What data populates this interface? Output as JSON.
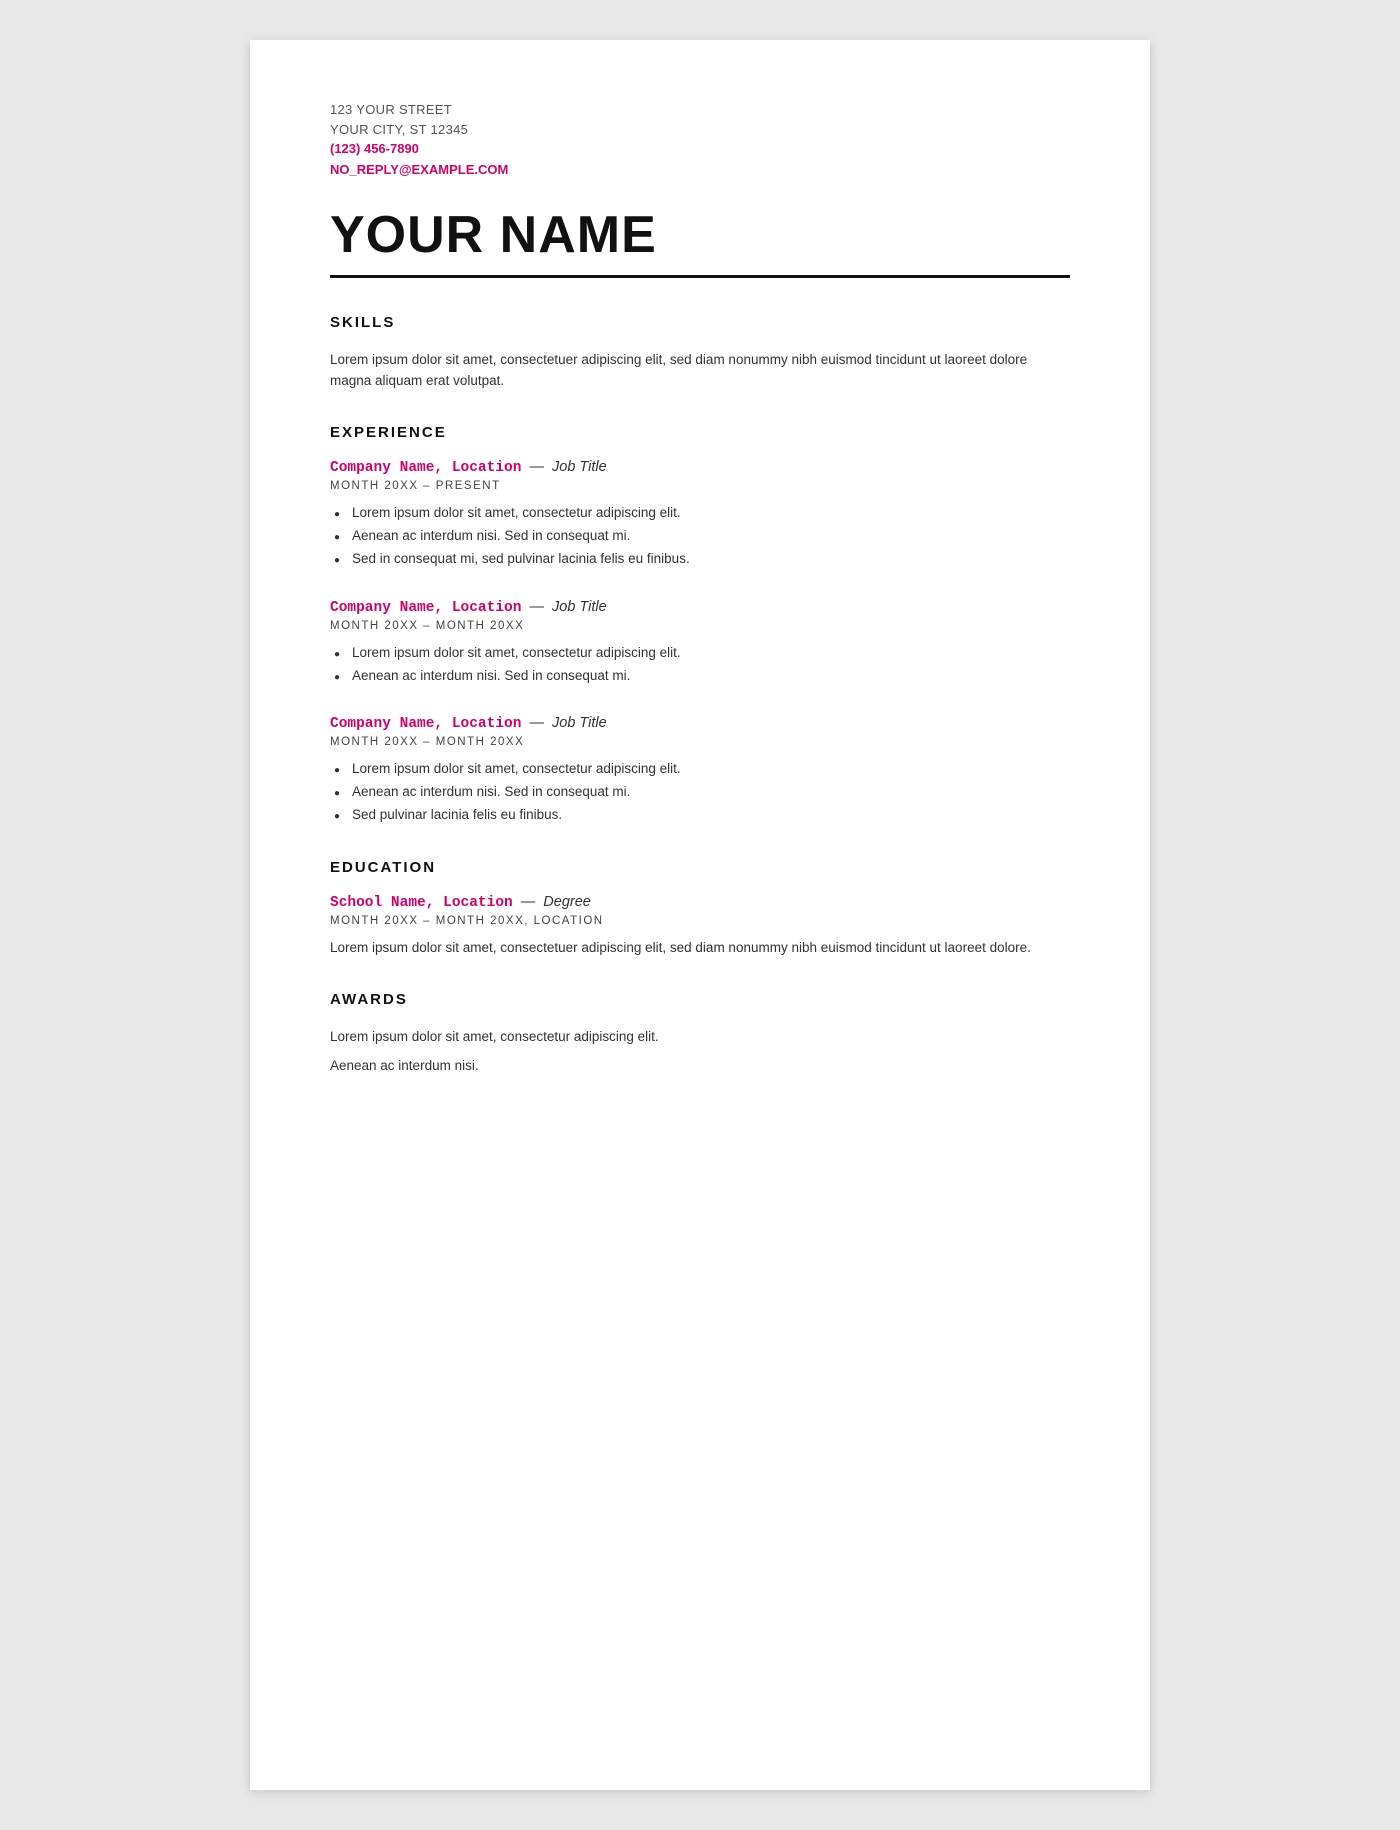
{
  "contact": {
    "street": "123 YOUR STREET",
    "city_state": "YOUR CITY, ST 12345",
    "phone": "(123) 456-7890",
    "email": "NO_REPLY@EXAMPLE.COM"
  },
  "name": "YOUR NAME",
  "divider": true,
  "sections": {
    "skills": {
      "title": "SKILLS",
      "body": "Lorem ipsum dolor sit amet, consectetuer adipiscing elit, sed diam nonummy nibh euismod tincidunt ut laoreet dolore magna aliquam erat volutpat."
    },
    "experience": {
      "title": "EXPERIENCE",
      "entries": [
        {
          "company": "Company Name, Location",
          "dash": "—",
          "job_title": "Job Title",
          "dates": "MONTH 20XX – PRESENT",
          "bullets": [
            "Lorem ipsum dolor sit amet, consectetur adipiscing elit.",
            "Aenean ac interdum nisi. Sed in consequat mi.",
            "Sed in consequat mi, sed pulvinar lacinia felis eu finibus."
          ]
        },
        {
          "company": "Company Name, Location",
          "dash": "—",
          "job_title": "Job Title",
          "dates": "MONTH 20XX – MONTH 20XX",
          "bullets": [
            "Lorem ipsum dolor sit amet, consectetur adipiscing elit.",
            "Aenean ac interdum nisi. Sed in consequat mi."
          ]
        },
        {
          "company": "Company Name, Location",
          "dash": "—",
          "job_title": "Job Title",
          "dates": "MONTH 20XX – MONTH 20XX",
          "bullets": [
            "Lorem ipsum dolor sit amet, consectetur adipiscing elit.",
            "Aenean ac interdum nisi. Sed in consequat mi.",
            "Sed pulvinar lacinia felis eu finibus."
          ]
        }
      ]
    },
    "education": {
      "title": "EDUCATION",
      "entries": [
        {
          "company": "School Name, Location",
          "dash": "—",
          "job_title": "Degree",
          "dates": "MONTH 20XX – MONTH 20XX, LOCATION",
          "description": "Lorem ipsum dolor sit amet, consectetuer adipiscing elit, sed diam nonummy nibh euismod tincidunt ut laoreet dolore."
        }
      ]
    },
    "awards": {
      "title": "AWARDS",
      "lines": [
        "Lorem ipsum dolor sit amet, consectetur adipiscing elit.",
        "Aenean ac interdum nisi."
      ]
    }
  }
}
